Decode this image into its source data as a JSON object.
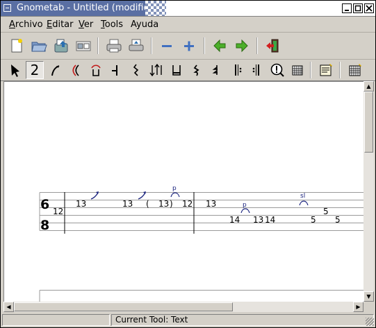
{
  "window": {
    "title": "Gnometab - Untitled (modified)",
    "controls": [
      "minimize-icon",
      "maximize-icon",
      "close-icon"
    ]
  },
  "menubar": [
    {
      "label": "Archivo",
      "mnemonic": "A",
      "rest": "rchivo"
    },
    {
      "label": "Editar",
      "mnemonic": "E",
      "rest": "ditar"
    },
    {
      "label": "Ver",
      "mnemonic": "V",
      "rest": "er"
    },
    {
      "label": "Tools",
      "mnemonic": "T",
      "rest": "ools"
    },
    {
      "label": "Ayuda",
      "mnemonic": "",
      "rest": "Ayuda"
    }
  ],
  "toolbar_main": [
    "new-file-icon",
    "open-file-icon",
    "save-file-icon",
    "properties-icon",
    "print-icon",
    "print-preview-icon",
    "zoom-out-icon",
    "zoom-in-icon",
    "previous-page-icon",
    "next-page-icon",
    "quit-icon"
  ],
  "toolbar_tools": {
    "text_tool_label": "2",
    "selected": "text-tool",
    "items": [
      "pointer-tool-icon",
      "text-tool-icon",
      "bend-tool-icon",
      "slur-tool-icon",
      "legato-tool-icon",
      "bar-line-tool-icon",
      "rest-tool-icon",
      "strum-tool-icon",
      "rhythm-tool-icon",
      "eighth-rest-icon",
      "quarter-rest-icon",
      "repeat-bar-icon",
      "double-bar-icon",
      "comment-tool-icon",
      "grid-tool-icon",
      "chord-tool-icon",
      "chord-grid-icon"
    ]
  },
  "tab": {
    "time_signature": {
      "top": "6",
      "bottom": "8"
    },
    "first_note": "12",
    "notes": [
      "13",
      "13",
      "(",
      "13",
      ")",
      "12",
      "13",
      "14",
      "13",
      "14",
      "5",
      "5",
      "5"
    ],
    "legato_labels": [
      "p",
      "p",
      "sl"
    ],
    "accent": "#1a237e"
  },
  "status": {
    "text": "Current Tool: Text"
  }
}
